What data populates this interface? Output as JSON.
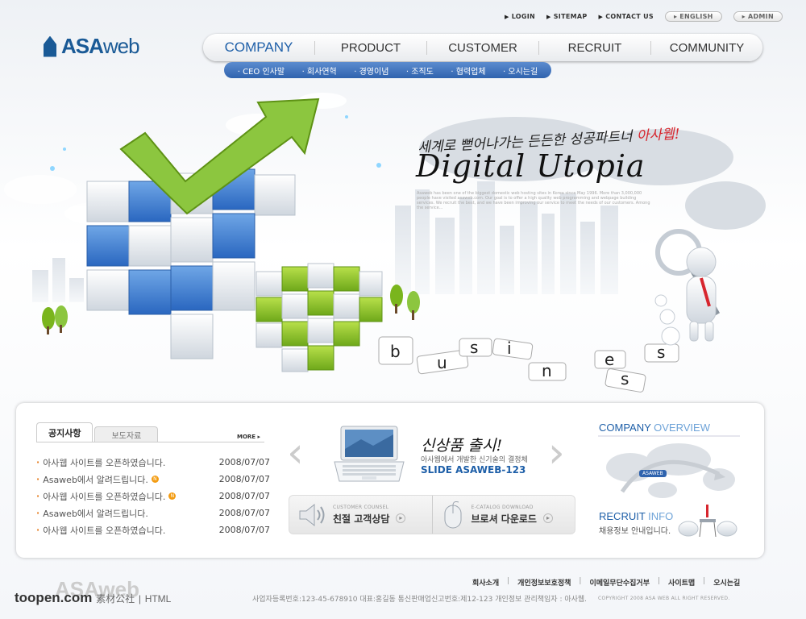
{
  "top_links": [
    "LOGIN",
    "SITEMAP",
    "CONTACT US"
  ],
  "lang_buttons": [
    "ENGLISH",
    "ADMIN"
  ],
  "logo": {
    "bold": "ASA",
    "light": "web"
  },
  "nav": [
    "COMPANY",
    "PRODUCT",
    "CUSTOMER",
    "RECRUIT",
    "COMMUNITY"
  ],
  "subnav": [
    "CEO 인사말",
    "회사연혁",
    "경영이념",
    "조직도",
    "협력업체",
    "오시는길"
  ],
  "hero": {
    "slogan_prefix": "세계로 뻗어나가는 든든한 성공파트너",
    "slogan_brand": "아사웹!",
    "headline": "Digital Utopia",
    "body": "Asaweb has been one of the biggest domestic web hosting sites in Korea since May 1996. More than 3,000,000 people have visited asaweb.com. Our goal is to offer a high quality web programming and webpage building services. We recruit the best, and we have been improving our service to meet the needs of our customers. Among the service...",
    "letters": [
      "b",
      "u",
      "s",
      "i",
      "n",
      "e",
      "s",
      "s"
    ]
  },
  "notice": {
    "tab_active": "공지사항",
    "tab_other": "보도자료",
    "more": "MORE",
    "items": [
      {
        "title": "아사웹 사이트를 오픈하였습니다.",
        "date": "2008/07/07",
        "new": false
      },
      {
        "title": "Asaweb에서 알려드립니다.",
        "date": "2008/07/07",
        "new": true
      },
      {
        "title": "아사웹 사이트를 오픈하였습니다.",
        "date": "2008/07/07",
        "new": true
      },
      {
        "title": "Asaweb에서 알려드립니다.",
        "date": "2008/07/07",
        "new": false
      },
      {
        "title": "아사웹 사이트를 오픈하였습니다.",
        "date": "2008/07/07",
        "new": false
      }
    ],
    "new_badge": "N"
  },
  "product": {
    "title": "신상품 출시!",
    "subtitle": "아사웹에서 개발한 신기술의 결정체",
    "slide": "SLIDE ASAWEB-123"
  },
  "services": [
    {
      "label": "CUSTOMER COUNSEL",
      "title": "친절 고객상담"
    },
    {
      "label": "E-CATALOG DOWNLOAD",
      "title": "브로셔 다운로드"
    }
  ],
  "overview": {
    "title_a": "COMPANY",
    "title_b": "OVERVIEW",
    "badge": "ASAWEB"
  },
  "recruit": {
    "title_a": "RECRUIT",
    "title_b": "INFO",
    "sub": "채용정보 안내입니다."
  },
  "footer": {
    "links": [
      "회사소개",
      "개인정보보호정책",
      "이메일무단수집거부",
      "사이트맵",
      "오시는길"
    ],
    "address": "사업자등록번호:123-45-678910 대표:홍길동 통신판매업신고번호:제12-123 개인정보 관리책임자 : 아사웹.",
    "copyright": "COPYRIGHT 2008 ASA WEB ALL RIGHT RESERVED.",
    "logo": "ASAweb"
  },
  "watermark": {
    "site": "toopen.com",
    "cn": "素材公社",
    "type": "HTML"
  },
  "colors": {
    "brand": "#1e5fa8",
    "accent": "#d7262e",
    "green": "#7ab51d"
  }
}
